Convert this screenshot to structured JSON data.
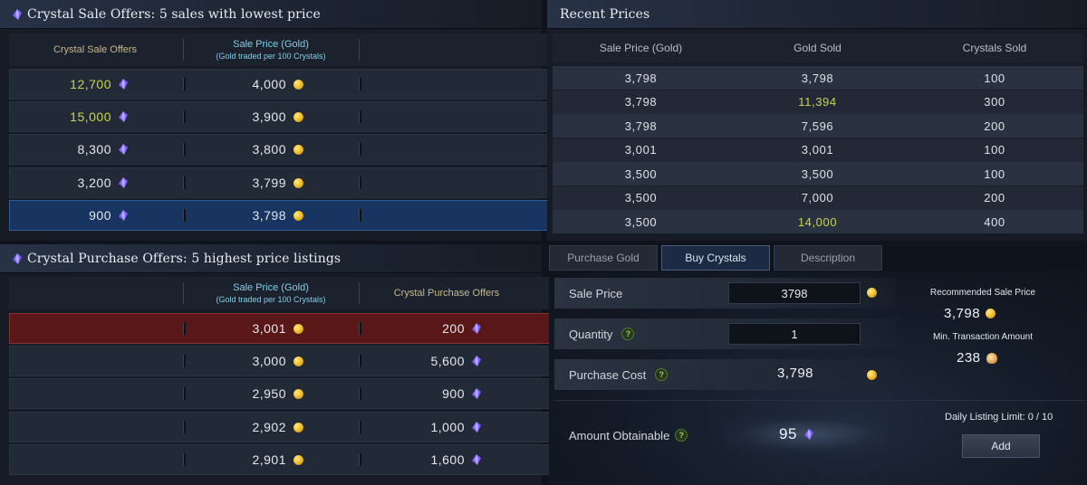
{
  "sale_panel": {
    "title": "Crystal Sale Offers: 5 sales with lowest price",
    "col1": "Crystal Sale Offers",
    "col2": "Sale Price (Gold)",
    "col2_sub": "(Gold traded per 100 Crystals)",
    "rows": [
      {
        "crystals": "12,700",
        "price": "4,000",
        "highlight": true
      },
      {
        "crystals": "15,000",
        "price": "3,900",
        "highlight": true
      },
      {
        "crystals": "8,300",
        "price": "3,800",
        "highlight": false
      },
      {
        "crystals": "3,200",
        "price": "3,799",
        "highlight": false
      },
      {
        "crystals": "900",
        "price": "3,798",
        "highlight": false
      }
    ]
  },
  "purchase_panel": {
    "title": "Crystal Purchase Offers: 5 highest price listings",
    "col1": "Sale Price (Gold)",
    "col1_sub": "(Gold traded per 100 Crystals)",
    "col2": "Crystal Purchase Offers",
    "rows": [
      {
        "price": "3,001",
        "crystals": "200"
      },
      {
        "price": "3,000",
        "crystals": "5,600"
      },
      {
        "price": "2,950",
        "crystals": "900"
      },
      {
        "price": "2,902",
        "crystals": "1,000"
      },
      {
        "price": "2,901",
        "crystals": "1,600"
      }
    ]
  },
  "recent_prices": {
    "title": "Recent Prices",
    "headers": [
      "Sale Price (Gold)",
      "Gold Sold",
      "Crystals Sold"
    ],
    "rows": [
      [
        "3,798",
        "3,798",
        "100"
      ],
      [
        "3,798",
        "11,394",
        "300"
      ],
      [
        "3,798",
        "7,596",
        "200"
      ],
      [
        "3,001",
        "3,001",
        "100"
      ],
      [
        "3,500",
        "3,500",
        "100"
      ],
      [
        "3,500",
        "7,000",
        "200"
      ],
      [
        "3,500",
        "14,000",
        "400"
      ]
    ]
  },
  "tabs": [
    {
      "label": "Purchase Gold"
    },
    {
      "label": "Buy Crystals"
    },
    {
      "label": "Description"
    }
  ],
  "buy_form": {
    "sale_price_label": "Sale Price",
    "sale_price_value": "3798",
    "quantity_label": "Quantity",
    "quantity_value": "1",
    "purchase_cost_label": "Purchase Cost",
    "purchase_cost_value": "3,798",
    "amount_obtainable_label": "Amount Obtainable",
    "amount_obtainable_value": "95",
    "recommended_label": "Recommended Sale Price",
    "recommended_value": "3,798",
    "min_transaction_label": "Min. Transaction Amount",
    "min_transaction_value": "238",
    "daily_limit_label": "Daily Listing Limit: 0 / 10",
    "add_label": "Add",
    "help_mark": "?"
  },
  "colors": {
    "highlight_text": "#c6d64a",
    "selected_row": "#173560",
    "red_row": "#5a1717",
    "gold_coin": "#f2c233",
    "crystal": "#7b5cff"
  }
}
